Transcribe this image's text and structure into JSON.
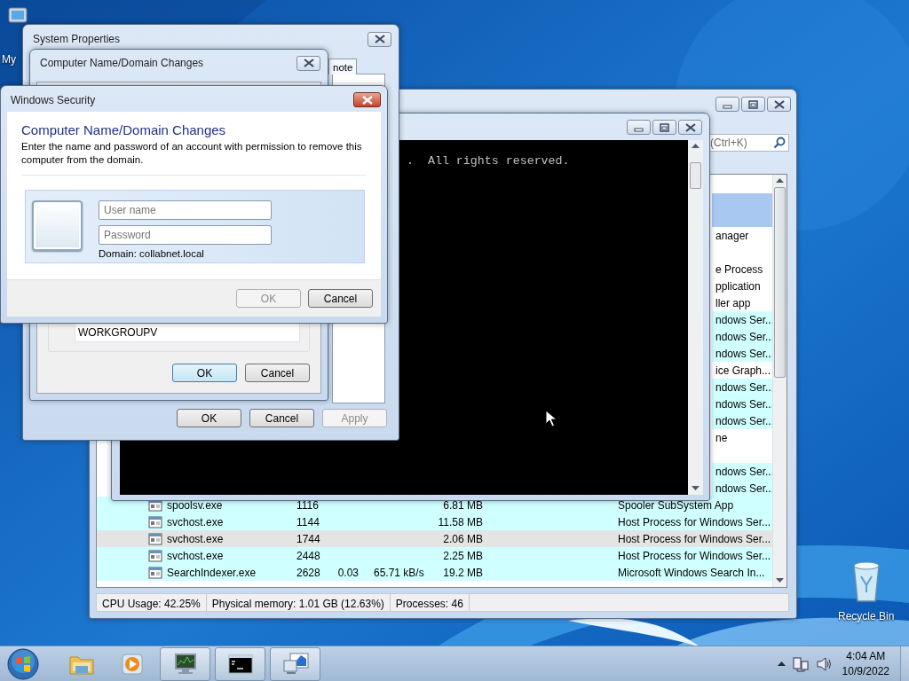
{
  "desktop_icons": [
    {
      "kind": "computer",
      "label": "My"
    },
    {
      "kind": "recycle",
      "label": "Recycle Bin"
    }
  ],
  "process_explorer": {
    "search_placeholder": "(Ctrl+K)",
    "rows": [
      {
        "service": false,
        "selected": false,
        "hovered": false
      },
      {
        "service": false,
        "selected": true,
        "hovered": false
      },
      {
        "service": false,
        "selected": true,
        "hovered": false
      },
      {
        "description": "anager",
        "service": false,
        "selected": false,
        "hovered": false
      },
      {
        "service": false,
        "selected": false,
        "hovered": false
      },
      {
        "description": "e Process",
        "service": false,
        "selected": false,
        "hovered": false
      },
      {
        "description": "pplication",
        "service": false,
        "selected": false,
        "hovered": false
      },
      {
        "description": "ller app",
        "service": false,
        "selected": false,
        "hovered": false
      },
      {
        "description": "ndows Ser...",
        "service": true,
        "selected": false,
        "hovered": false
      },
      {
        "description": "ndows Ser...",
        "service": true,
        "selected": false,
        "hovered": false
      },
      {
        "description": "ndows Ser...",
        "service": true,
        "selected": false,
        "hovered": false
      },
      {
        "description": "ice Graph...",
        "service": false,
        "selected": false,
        "hovered": false
      },
      {
        "description": "ndows Ser...",
        "service": true,
        "selected": false,
        "hovered": false
      },
      {
        "description": "ndows Ser...",
        "service": true,
        "selected": false,
        "hovered": false
      },
      {
        "description": "ndows Ser...",
        "service": true,
        "selected": false,
        "hovered": false
      },
      {
        "description": "ne",
        "service": false,
        "selected": false,
        "hovered": false
      },
      {
        "service": false,
        "selected": false,
        "hovered": false
      },
      {
        "description": "ndows Ser...",
        "service": true,
        "selected": false,
        "hovered": false
      },
      {
        "description": "ndows Ser...",
        "service": true,
        "selected": false,
        "hovered": false
      },
      {
        "name": "spoolsv.exe",
        "pid": "1116",
        "private_bytes": "6.81 MB",
        "description": "Spooler SubSystem App",
        "service": true,
        "selected": false,
        "hovered": false
      },
      {
        "name": "svchost.exe",
        "pid": "1144",
        "private_bytes": "11.58 MB",
        "description": "Host Process for Windows Ser...",
        "service": true,
        "selected": false,
        "hovered": false
      },
      {
        "name": "svchost.exe",
        "pid": "1744",
        "private_bytes": "2.06 MB",
        "description": "Host Process for Windows Ser...",
        "service": true,
        "selected": false,
        "hovered": true
      },
      {
        "name": "svchost.exe",
        "pid": "2448",
        "private_bytes": "2.25 MB",
        "description": "Host Process for Windows Ser...",
        "service": true,
        "selected": false,
        "hovered": false
      },
      {
        "name": "SearchIndexer.exe",
        "pid": "2628",
        "cpu": "0.03",
        "io": "65.71 kB/s",
        "private_bytes": "19.2 MB",
        "description": "Microsoft Windows Search In...",
        "service": true,
        "selected": false,
        "hovered": false
      }
    ],
    "status_bar": [
      "CPU Usage: 42.25%",
      "Physical memory: 1.01 GB (12.63%)",
      "Processes: 46"
    ]
  },
  "console": {
    "lines": [
      ".  All rights reserved."
    ]
  },
  "system_properties": {
    "title": "System Properties",
    "tabs": [
      {
        "label": "note",
        "selected": false
      }
    ],
    "buttons": [
      {
        "label": "OK",
        "disabled": false
      },
      {
        "label": "Cancel",
        "disabled": false
      },
      {
        "label": "Apply",
        "disabled": true
      }
    ]
  },
  "name_changes": {
    "title": "Computer Name/Domain Changes",
    "workgroup": "WORKGROUPV",
    "buttons": [
      {
        "label": "OK",
        "default": true
      },
      {
        "label": "Cancel",
        "default": false
      }
    ]
  },
  "security": {
    "title": "Windows Security",
    "heading": "Computer Name/Domain Changes",
    "message": "Enter the name and password of an account with permission to remove this computer from the domain.",
    "username_placeholder": "User name",
    "password_placeholder": "Password",
    "domain": "Domain: collabnet.local",
    "buttons": [
      {
        "label": "OK",
        "disabled": true
      },
      {
        "label": "Cancel",
        "disabled": false
      }
    ]
  },
  "taskbar": {
    "items": [
      {
        "kind": "folder",
        "running": false
      },
      {
        "kind": "media",
        "running": false
      },
      {
        "kind": "monitor",
        "running": true
      },
      {
        "kind": "console",
        "running": true
      },
      {
        "kind": "network",
        "running": true
      }
    ],
    "clock_time": "4:04 AM",
    "clock_date": "10/9/2022"
  }
}
